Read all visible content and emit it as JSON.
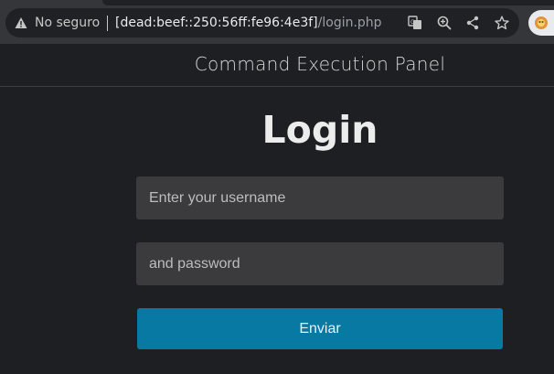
{
  "browser": {
    "security_label": "No seguro",
    "url_host": "[dead:beef::250:56ff:fe96:4e3f]",
    "url_path": "/login.php",
    "icons": [
      "warning-icon",
      "translate-icon",
      "zoom-icon",
      "share-icon",
      "bookmark-star-icon",
      "extension-icon"
    ]
  },
  "header": {
    "title": "Command Execution Panel"
  },
  "login": {
    "title": "Login",
    "username_placeholder": "Enter your username",
    "password_placeholder": "and password",
    "submit_label": "Enviar"
  },
  "colors": {
    "background": "#1e1f22",
    "field": "#3b3b3d",
    "button": "#0779a3"
  }
}
